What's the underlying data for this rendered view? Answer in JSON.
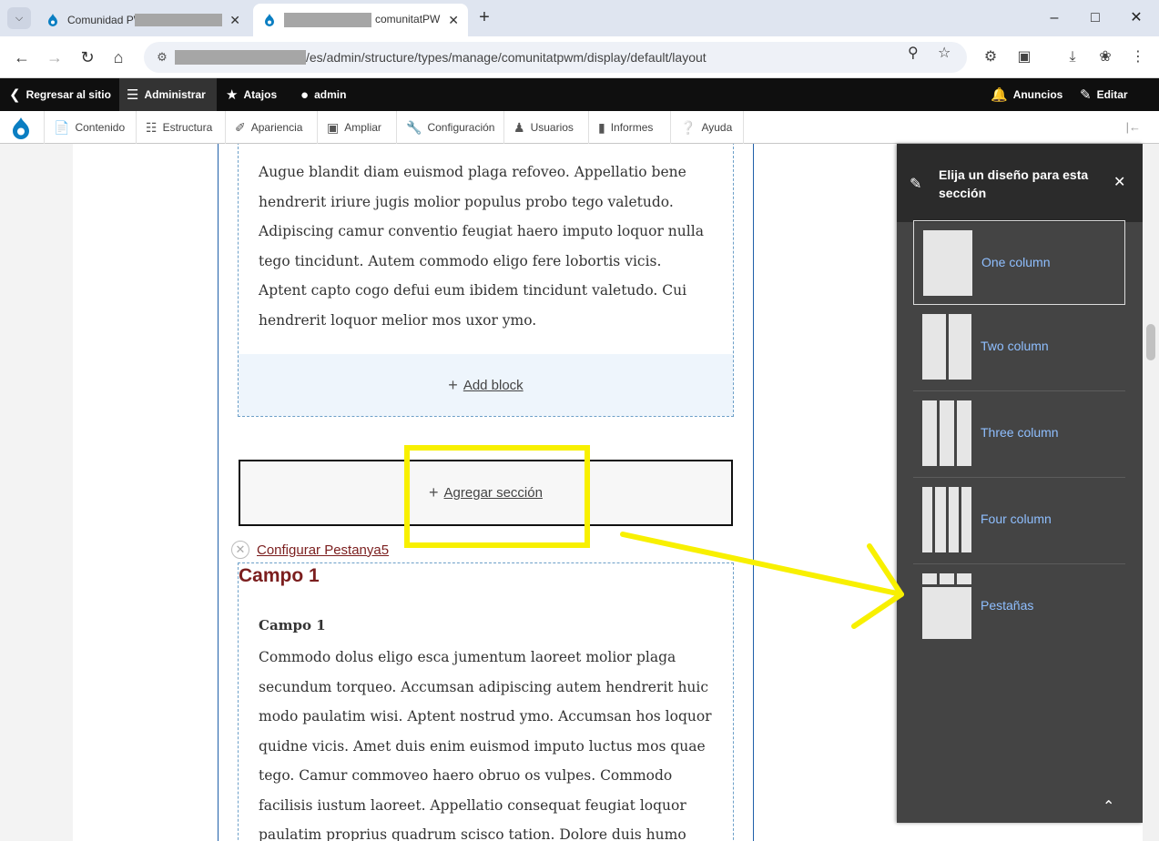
{
  "browser": {
    "tabs": [
      {
        "title": "Comunidad PW",
        "active": false
      },
      {
        "title": "comunitatPW",
        "active": true
      }
    ],
    "url": "/es/admin/structure/types/manage/comunitatpwm/display/default/layout"
  },
  "toolbar": {
    "back_to_site": "Regresar al sitio",
    "manage": "Administrar",
    "shortcuts": "Atajos",
    "user": "admin",
    "announcements": "Anuncios",
    "edit": "Editar"
  },
  "admin_menu": [
    "Contenido",
    "Estructura",
    "Apariencia",
    "Ampliar",
    "Configuración",
    "Usuarios",
    "Informes",
    "Ayuda"
  ],
  "content": {
    "paragraph1": "Augue blandit diam euismod plaga refoveo. Appellatio bene hendrerit iriure jugis molior populus probo tego valetudo. Adipiscing camur conventio feugiat haero imputo loquor nulla tego tincidunt. Autem commodo eligo fere lobortis vicis. Aptent capto cogo defui eum ibidem tincidunt valetudo. Cui hendrerit loquor melior mos uxor ymo.",
    "add_block": "Add block",
    "add_section": "Agregar sección",
    "configure_link": "Configurar Pestanya5",
    "section_title": "Campo 1",
    "field_label": "Campo 1",
    "paragraph2": "Commodo dolus eligo esca jumentum laoreet molior plaga secundum torqueo. Accumsan adipiscing autem hendrerit huic modo paulatim wisi. Aptent nostrud ymo. Accumsan hos loquor quidne vicis. Amet duis enim euismod imputo luctus mos quae tego. Camur commoveo haero obruo os vulpes. Commodo facilisis iustum laoreet. Appellatio consequat feugiat loquor paulatim proprius quadrum scisco tation. Dolore duis humo immitto tego"
  },
  "dialog": {
    "title": "Elija un diseño para esta sección",
    "options": [
      {
        "label": "One column",
        "columns": 1
      },
      {
        "label": "Two column",
        "columns": 2
      },
      {
        "label": "Three column",
        "columns": 3
      },
      {
        "label": "Four column",
        "columns": 4
      },
      {
        "label": "Pestañas",
        "columns": 0
      }
    ]
  },
  "colors": {
    "highlight": "#f8f000",
    "link_blue": "#8fbfff",
    "section_title": "#7b1e1e",
    "dialog_bg": "#444444"
  }
}
